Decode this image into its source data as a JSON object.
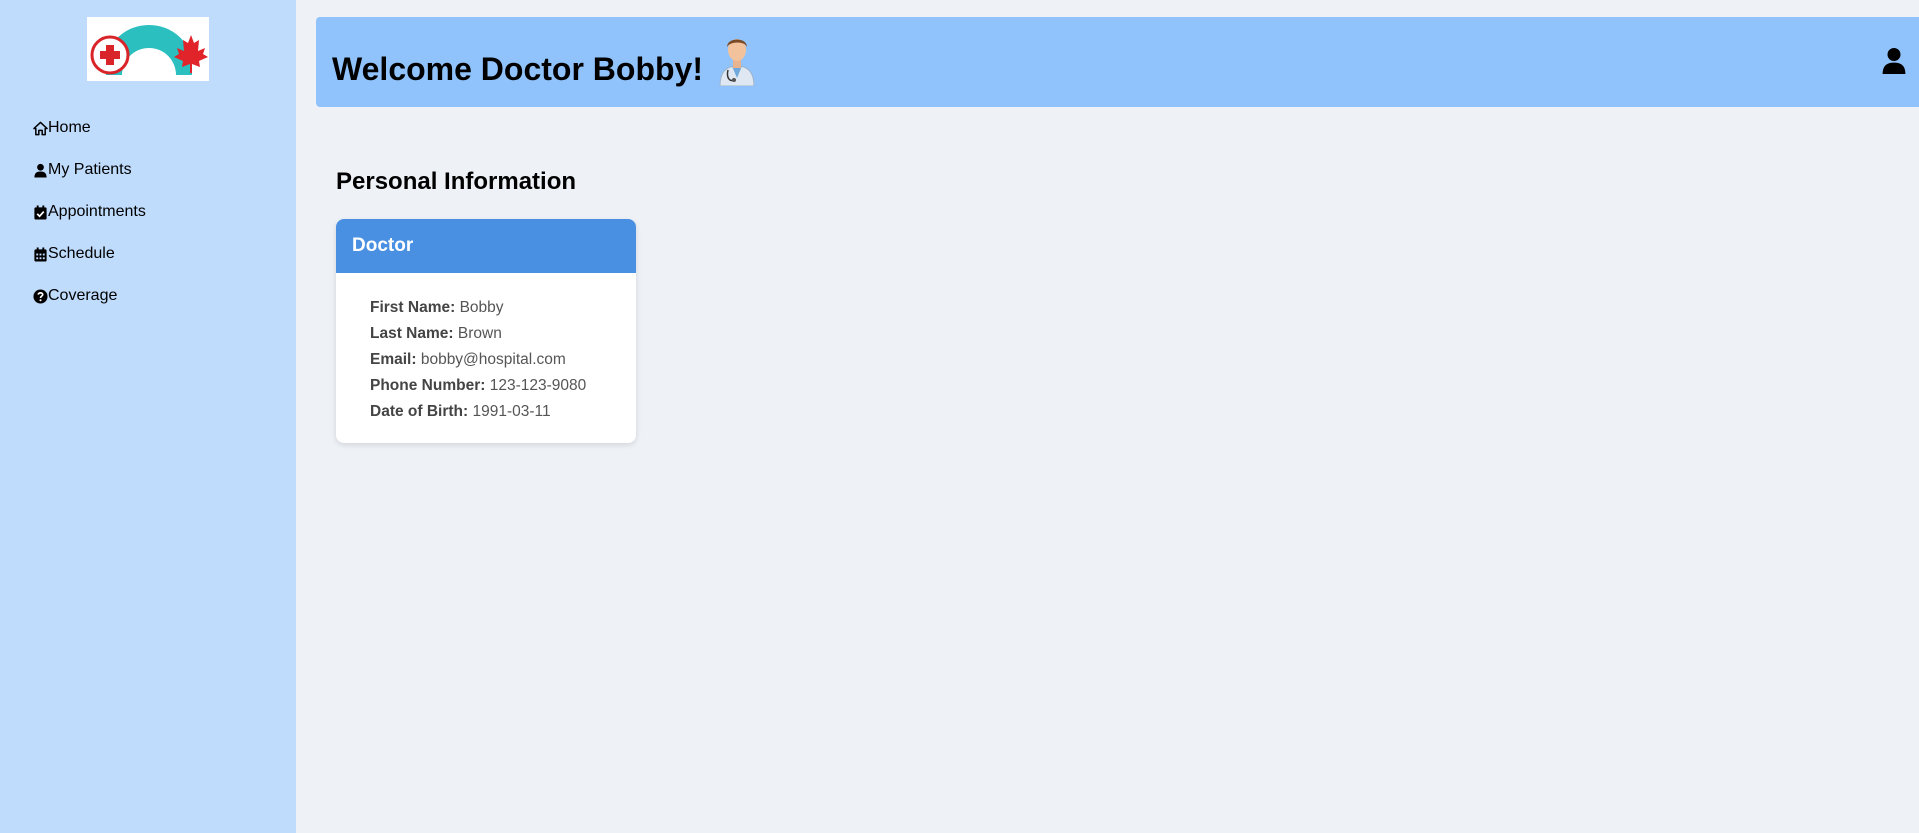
{
  "sidebar": {
    "logo_name": "hospital-logo",
    "items": [
      {
        "label": "Home",
        "icon": "home-icon"
      },
      {
        "label": "My Patients",
        "icon": "user-icon"
      },
      {
        "label": "Appointments",
        "icon": "calendar-check-icon"
      },
      {
        "label": "Schedule",
        "icon": "calendar-icon"
      },
      {
        "label": "Coverage",
        "icon": "question-circle-icon"
      }
    ]
  },
  "header": {
    "title": "Welcome Doctor Bobby!",
    "avatar_icon": "doctor-icon",
    "profile_icon": "user-icon",
    "color": "#90c3fb"
  },
  "main": {
    "section_title": "Personal Information",
    "card": {
      "title": "Doctor",
      "header_color": "#4a90e2",
      "fields": [
        {
          "label": "First Name:",
          "value": "Bobby"
        },
        {
          "label": "Last Name:",
          "value": "Brown"
        },
        {
          "label": "Email:",
          "value": "bobby@hospital.com"
        },
        {
          "label": "Phone Number:",
          "value": "123-123-9080"
        },
        {
          "label": "Date of Birth:",
          "value": "1991-03-11"
        }
      ]
    }
  }
}
